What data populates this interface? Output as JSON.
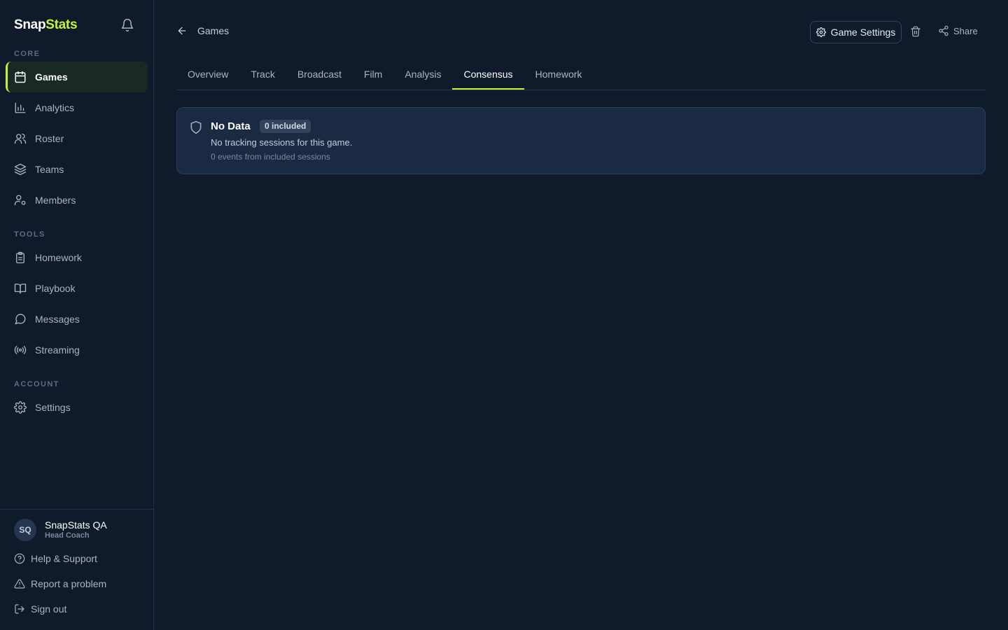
{
  "app": {
    "brand_part1": "Snap",
    "brand_part2": "Stats",
    "accent_color": "#c6f432"
  },
  "sidebar": {
    "sections": {
      "core": "CORE",
      "tools": "TOOLS",
      "account": "ACCOUNT"
    },
    "items": [
      {
        "label": "Games",
        "icon": "calendar-icon",
        "active": true
      },
      {
        "label": "Analytics",
        "icon": "bar-chart-icon"
      },
      {
        "label": "Roster",
        "icon": "users-icon"
      },
      {
        "label": "Teams",
        "icon": "layers-icon"
      },
      {
        "label": "Members",
        "icon": "user-cog-icon"
      },
      {
        "label": "Homework",
        "icon": "clipboard-icon"
      },
      {
        "label": "Playbook",
        "icon": "book-open-icon"
      },
      {
        "label": "Messages",
        "icon": "message-circle-icon"
      },
      {
        "label": "Streaming",
        "icon": "broadcast-icon"
      },
      {
        "label": "Settings",
        "icon": "gear-icon"
      }
    ],
    "user": {
      "initials": "SQ",
      "name": "SnapStats QA",
      "role": "Head Coach"
    },
    "footer": {
      "help": "Help & Support",
      "report": "Report a problem",
      "signout": "Sign out"
    }
  },
  "header": {
    "back_label": "Games",
    "settings_label": "Game Settings",
    "share_label": "Share"
  },
  "tabs": [
    {
      "label": "Overview"
    },
    {
      "label": "Track"
    },
    {
      "label": "Broadcast"
    },
    {
      "label": "Film"
    },
    {
      "label": "Analysis"
    },
    {
      "label": "Consensus",
      "active": true
    },
    {
      "label": "Homework"
    }
  ],
  "card": {
    "title": "No Data",
    "badge": "0 included",
    "description": "No tracking sessions for this game.",
    "subtext": "0 events from included sessions"
  }
}
